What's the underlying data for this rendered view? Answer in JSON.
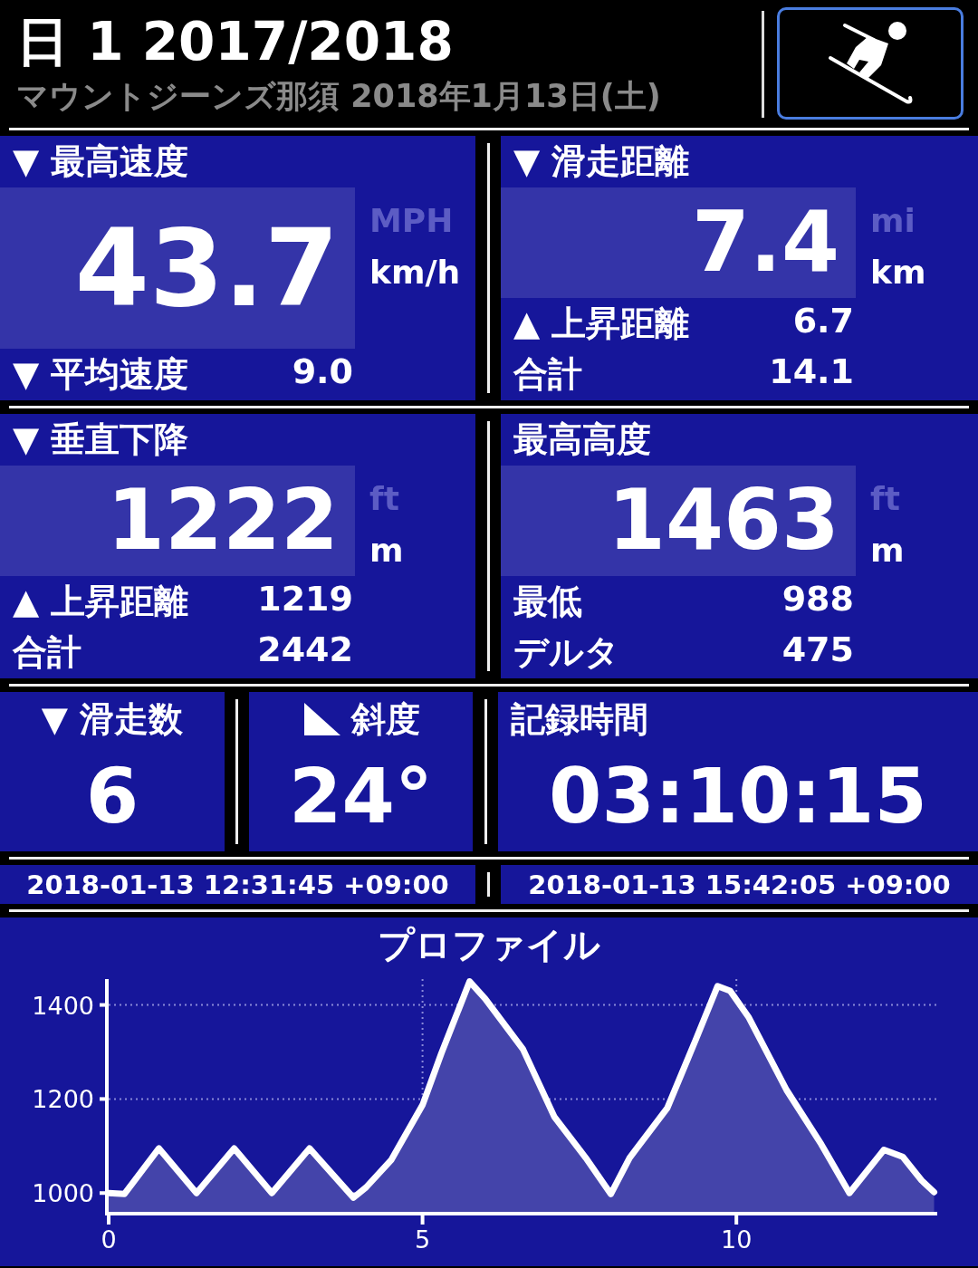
{
  "header": {
    "title": "日 1 2017/2018",
    "subtitle": "マウントジーンズ那須 2018年1月13日(土)"
  },
  "stat_panels": [
    {
      "label": "▼ 最高速度",
      "value": "43.7",
      "unit_alt": "MPH",
      "unit": "km/h",
      "rows": [
        {
          "label": "▼ 平均速度",
          "value": "9.0"
        }
      ]
    },
    {
      "label": "▼ 滑走距離",
      "value": "7.4",
      "unit_alt": "mi",
      "unit": "km",
      "rows": [
        {
          "label": "▲ 上昇距離",
          "value": "6.7"
        },
        {
          "label": "合計",
          "value": "14.1"
        }
      ]
    },
    {
      "label": "▼ 垂直下降",
      "value": "1222",
      "unit_alt": "ft",
      "unit": "m",
      "rows": [
        {
          "label": "▲ 上昇距離",
          "value": "1219"
        },
        {
          "label": "合計",
          "value": "2442"
        }
      ]
    },
    {
      "label": "最高高度",
      "value": "1463",
      "unit_alt": "ft",
      "unit": "m",
      "rows": [
        {
          "label": "最低",
          "value": "988"
        },
        {
          "label": "デルタ",
          "value": "475"
        }
      ]
    }
  ],
  "small_panels": [
    {
      "kind": "plain",
      "label": "▼ 滑走数",
      "value": "6"
    },
    {
      "kind": "slope",
      "label": "斜度",
      "value": "24°"
    },
    {
      "kind": "plain",
      "label": "記録時間",
      "value": "03:10:15"
    }
  ],
  "timestamps": [
    "2018-01-13 12:31:45 +09:00",
    "2018-01-13 15:42:05 +09:00"
  ],
  "profile": {
    "chart_data": {
      "type": "area",
      "title": "プロファイル",
      "xlim": [
        0,
        13.2
      ],
      "ylim": [
        960,
        1455
      ],
      "xticks": [
        0,
        5,
        10
      ],
      "yticks": [
        1000,
        1200,
        1400
      ],
      "x": [
        0,
        0.25,
        0.8,
        1.4,
        2.0,
        2.6,
        3.2,
        3.9,
        4.1,
        4.5,
        5.0,
        5.3,
        5.75,
        6.0,
        6.6,
        7.1,
        7.6,
        8.0,
        8.3,
        8.9,
        9.35,
        9.7,
        9.9,
        10.2,
        10.8,
        11.35,
        11.8,
        12.35,
        12.65,
        12.95,
        13.15
      ],
      "grid": true,
      "values": [
        1000,
        998,
        1095,
        1000,
        1095,
        1000,
        1095,
        990,
        1012,
        1070,
        1187,
        1297,
        1450,
        1413,
        1306,
        1162,
        1075,
        998,
        1075,
        1181,
        1325,
        1440,
        1430,
        1373,
        1219,
        1104,
        1000,
        1092,
        1077,
        1027,
        1002
      ]
    }
  }
}
